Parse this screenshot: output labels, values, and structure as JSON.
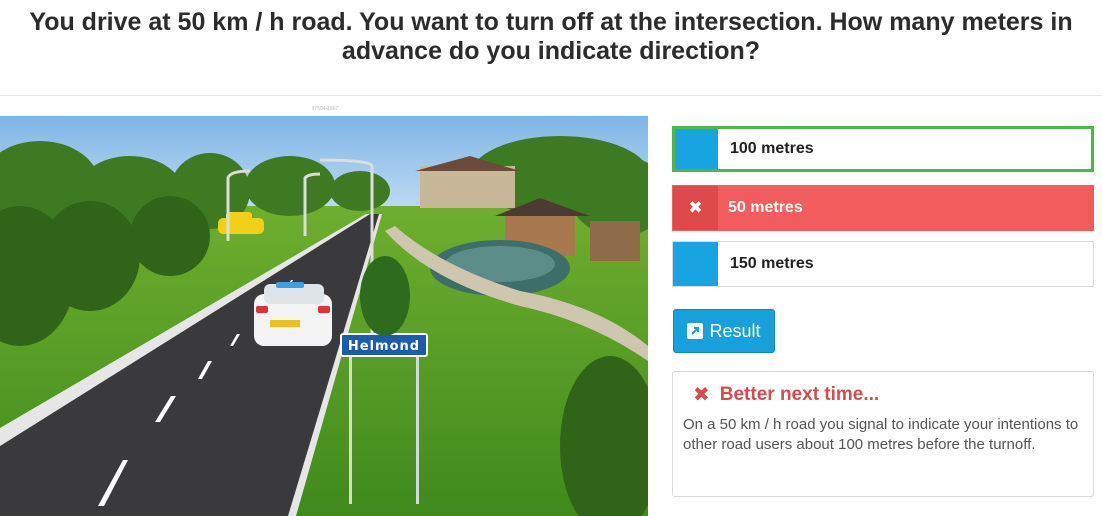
{
  "question": "You drive at 50 km / h road. You want to turn off at the intersection. How many meters in advance do you indicate direction?",
  "image": {
    "caption": "27594-1567",
    "sign_text": "Helmond"
  },
  "answers": [
    {
      "label": "100 metres",
      "state": "correct"
    },
    {
      "label": "50 metres",
      "state": "wrong",
      "icon": "✖"
    },
    {
      "label": "150 metres",
      "state": "neutral"
    }
  ],
  "result_button": {
    "label": "Result",
    "icon": "external-link-icon"
  },
  "feedback": {
    "icon": "✖",
    "title": "Better next time...",
    "text": "On a 50 km / h road you signal to indicate your intentions to other road users about 100 metres before the turnoff."
  },
  "colors": {
    "accent": "#18a4e0",
    "correct_border": "#4db84a",
    "wrong": "#f25c5c",
    "feedback_title": "#d94b4b"
  }
}
